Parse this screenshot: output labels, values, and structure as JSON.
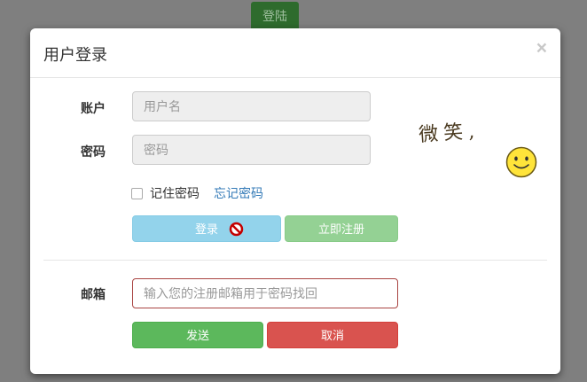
{
  "background_button": {
    "label": "登陆"
  },
  "modal": {
    "title": "用户登录",
    "close_glyph": "×"
  },
  "form": {
    "account_label": "账户",
    "username_placeholder": "用户名",
    "password_label": "密码",
    "password_placeholder": "密码",
    "remember_label": "记住密码",
    "forgot_link": "忘记密码",
    "login_button": "登录",
    "register_button": "立即注册"
  },
  "email_form": {
    "email_label": "邮箱",
    "email_placeholder": "输入您的注册邮箱用于密码找回",
    "send_button": "发送",
    "cancel_button": "取消"
  },
  "sticker": {
    "text": "微笑,",
    "icon": "smiley-icon"
  },
  "cursor": {
    "icon": "not-allowed-icon"
  },
  "colors": {
    "backdrop": "#7f7f7f",
    "login_button": "#93d3eb",
    "register_button": "#94d194",
    "send_button": "#5cb85c",
    "cancel_button": "#d9534f",
    "link": "#337ab7",
    "email_border": "#a94442"
  }
}
